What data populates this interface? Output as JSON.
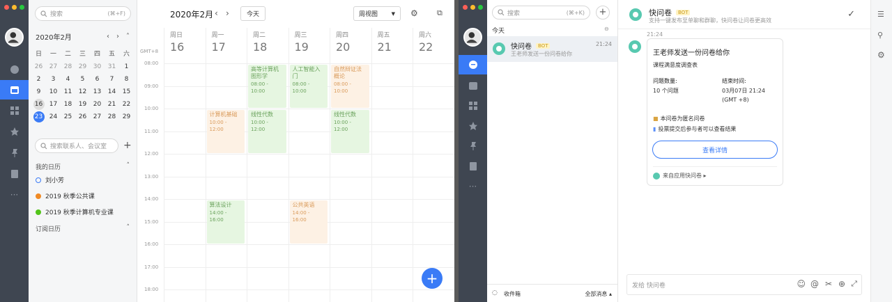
{
  "calendar_window": {
    "search": {
      "placeholder": "搜索",
      "shortcut": "(⌘+F)"
    },
    "mini": {
      "title": "2020年2月",
      "weekdays": [
        "日",
        "一",
        "二",
        "三",
        "四",
        "五",
        "六"
      ],
      "weeks": [
        [
          "26",
          "27",
          "28",
          "29",
          "30",
          "31",
          "1"
        ],
        [
          "2",
          "3",
          "4",
          "5",
          "6",
          "7",
          "8"
        ],
        [
          "9",
          "10",
          "11",
          "12",
          "13",
          "14",
          "15"
        ],
        [
          "16",
          "17",
          "18",
          "19",
          "20",
          "21",
          "22"
        ],
        [
          "23",
          "24",
          "25",
          "26",
          "27",
          "28",
          "29"
        ]
      ]
    },
    "contact_search": {
      "placeholder": "搜索联系人、会议室"
    },
    "my_calendars_label": "我的日历",
    "calendars": [
      {
        "name": "刘小芳",
        "color": "#3a7bf6",
        "ring": true
      },
      {
        "name": "2019 秋季公共课",
        "color": "#f08a24",
        "ring": false
      },
      {
        "name": "2019 秋季计算机专业课",
        "color": "#52c41a",
        "ring": false
      }
    ],
    "subscribed_label": "订阅日历",
    "header": {
      "title": "2020年2月",
      "today_btn": "今天",
      "view_select": "周视图"
    },
    "timezone": "GMT+8",
    "days": [
      {
        "week": "周日",
        "num": "16"
      },
      {
        "week": "周一",
        "num": "17"
      },
      {
        "week": "周二",
        "num": "18"
      },
      {
        "week": "周三",
        "num": "19"
      },
      {
        "week": "周四",
        "num": "20"
      },
      {
        "week": "周五",
        "num": "21"
      },
      {
        "week": "周六",
        "num": "22"
      }
    ],
    "hours": [
      "08:00",
      "09:00",
      "10:00",
      "11:00",
      "12:00",
      "13:00",
      "14:00",
      "15:00",
      "16:00",
      "17:00",
      "18:00"
    ],
    "events": [
      {
        "title": "高等计算机图形学",
        "time": "08:00 - 10:00",
        "day": 2,
        "start": 8,
        "end": 10,
        "color": "green"
      },
      {
        "title": "人工智能入门",
        "time": "08:00 - 10:00",
        "day": 3,
        "start": 8,
        "end": 10,
        "color": "green"
      },
      {
        "title": "自然辩证法概论",
        "time": "08:00 - 10:00",
        "day": 4,
        "start": 8,
        "end": 10,
        "color": "orange"
      },
      {
        "title": "计算机基础",
        "time": "10:00 - 12:00",
        "day": 1,
        "start": 10,
        "end": 12,
        "color": "orange"
      },
      {
        "title": "线性代数",
        "time": "10:00 - 12:00",
        "day": 2,
        "start": 10,
        "end": 12,
        "color": "green"
      },
      {
        "title": "线性代数",
        "time": "10:00 - 12:00",
        "day": 4,
        "start": 10,
        "end": 12,
        "color": "green"
      },
      {
        "title": "算法设计",
        "time": "14:00 - 16:00",
        "day": 1,
        "start": 14,
        "end": 16,
        "color": "green"
      },
      {
        "title": "公共英语",
        "time": "14:00 - 16:00",
        "day": 3,
        "start": 14,
        "end": 16,
        "color": "orange"
      }
    ],
    "fab": "+"
  },
  "chat_window": {
    "search": {
      "placeholder": "搜索",
      "shortcut": "(⌘+K)"
    },
    "section_label": "今天",
    "conversation": {
      "name": "快问卷",
      "badge": "BOT",
      "time": "21:24",
      "preview": "王老师发送一份问卷给你"
    },
    "footer": {
      "inbox": "收件箱",
      "all": "全部消息 ▴"
    },
    "header": {
      "name": "快问卷",
      "badge": "BOT",
      "desc": "支持一键发布至单聊和群聊，快问卷让问卷更高效"
    },
    "msg_time": "21:24",
    "card": {
      "title": "王老师发送一份问卷给你",
      "subtitle": "课程满意度调查表",
      "count_label": "问题数量:",
      "count_value": "10 个问题",
      "end_label": "结束时间:",
      "end_value": "03月07日 21:24",
      "end_tz": "(GMT +8)",
      "note1": "本问卷为匿名问卷",
      "note2": "投票提交后参与者可以查看结果",
      "button": "查看详情",
      "source": "来自应用快问卷 ▸"
    },
    "input_placeholder": "发给 快问卷"
  },
  "colors": {
    "accent": "#3a7bf6",
    "rail": "#3f4651"
  }
}
